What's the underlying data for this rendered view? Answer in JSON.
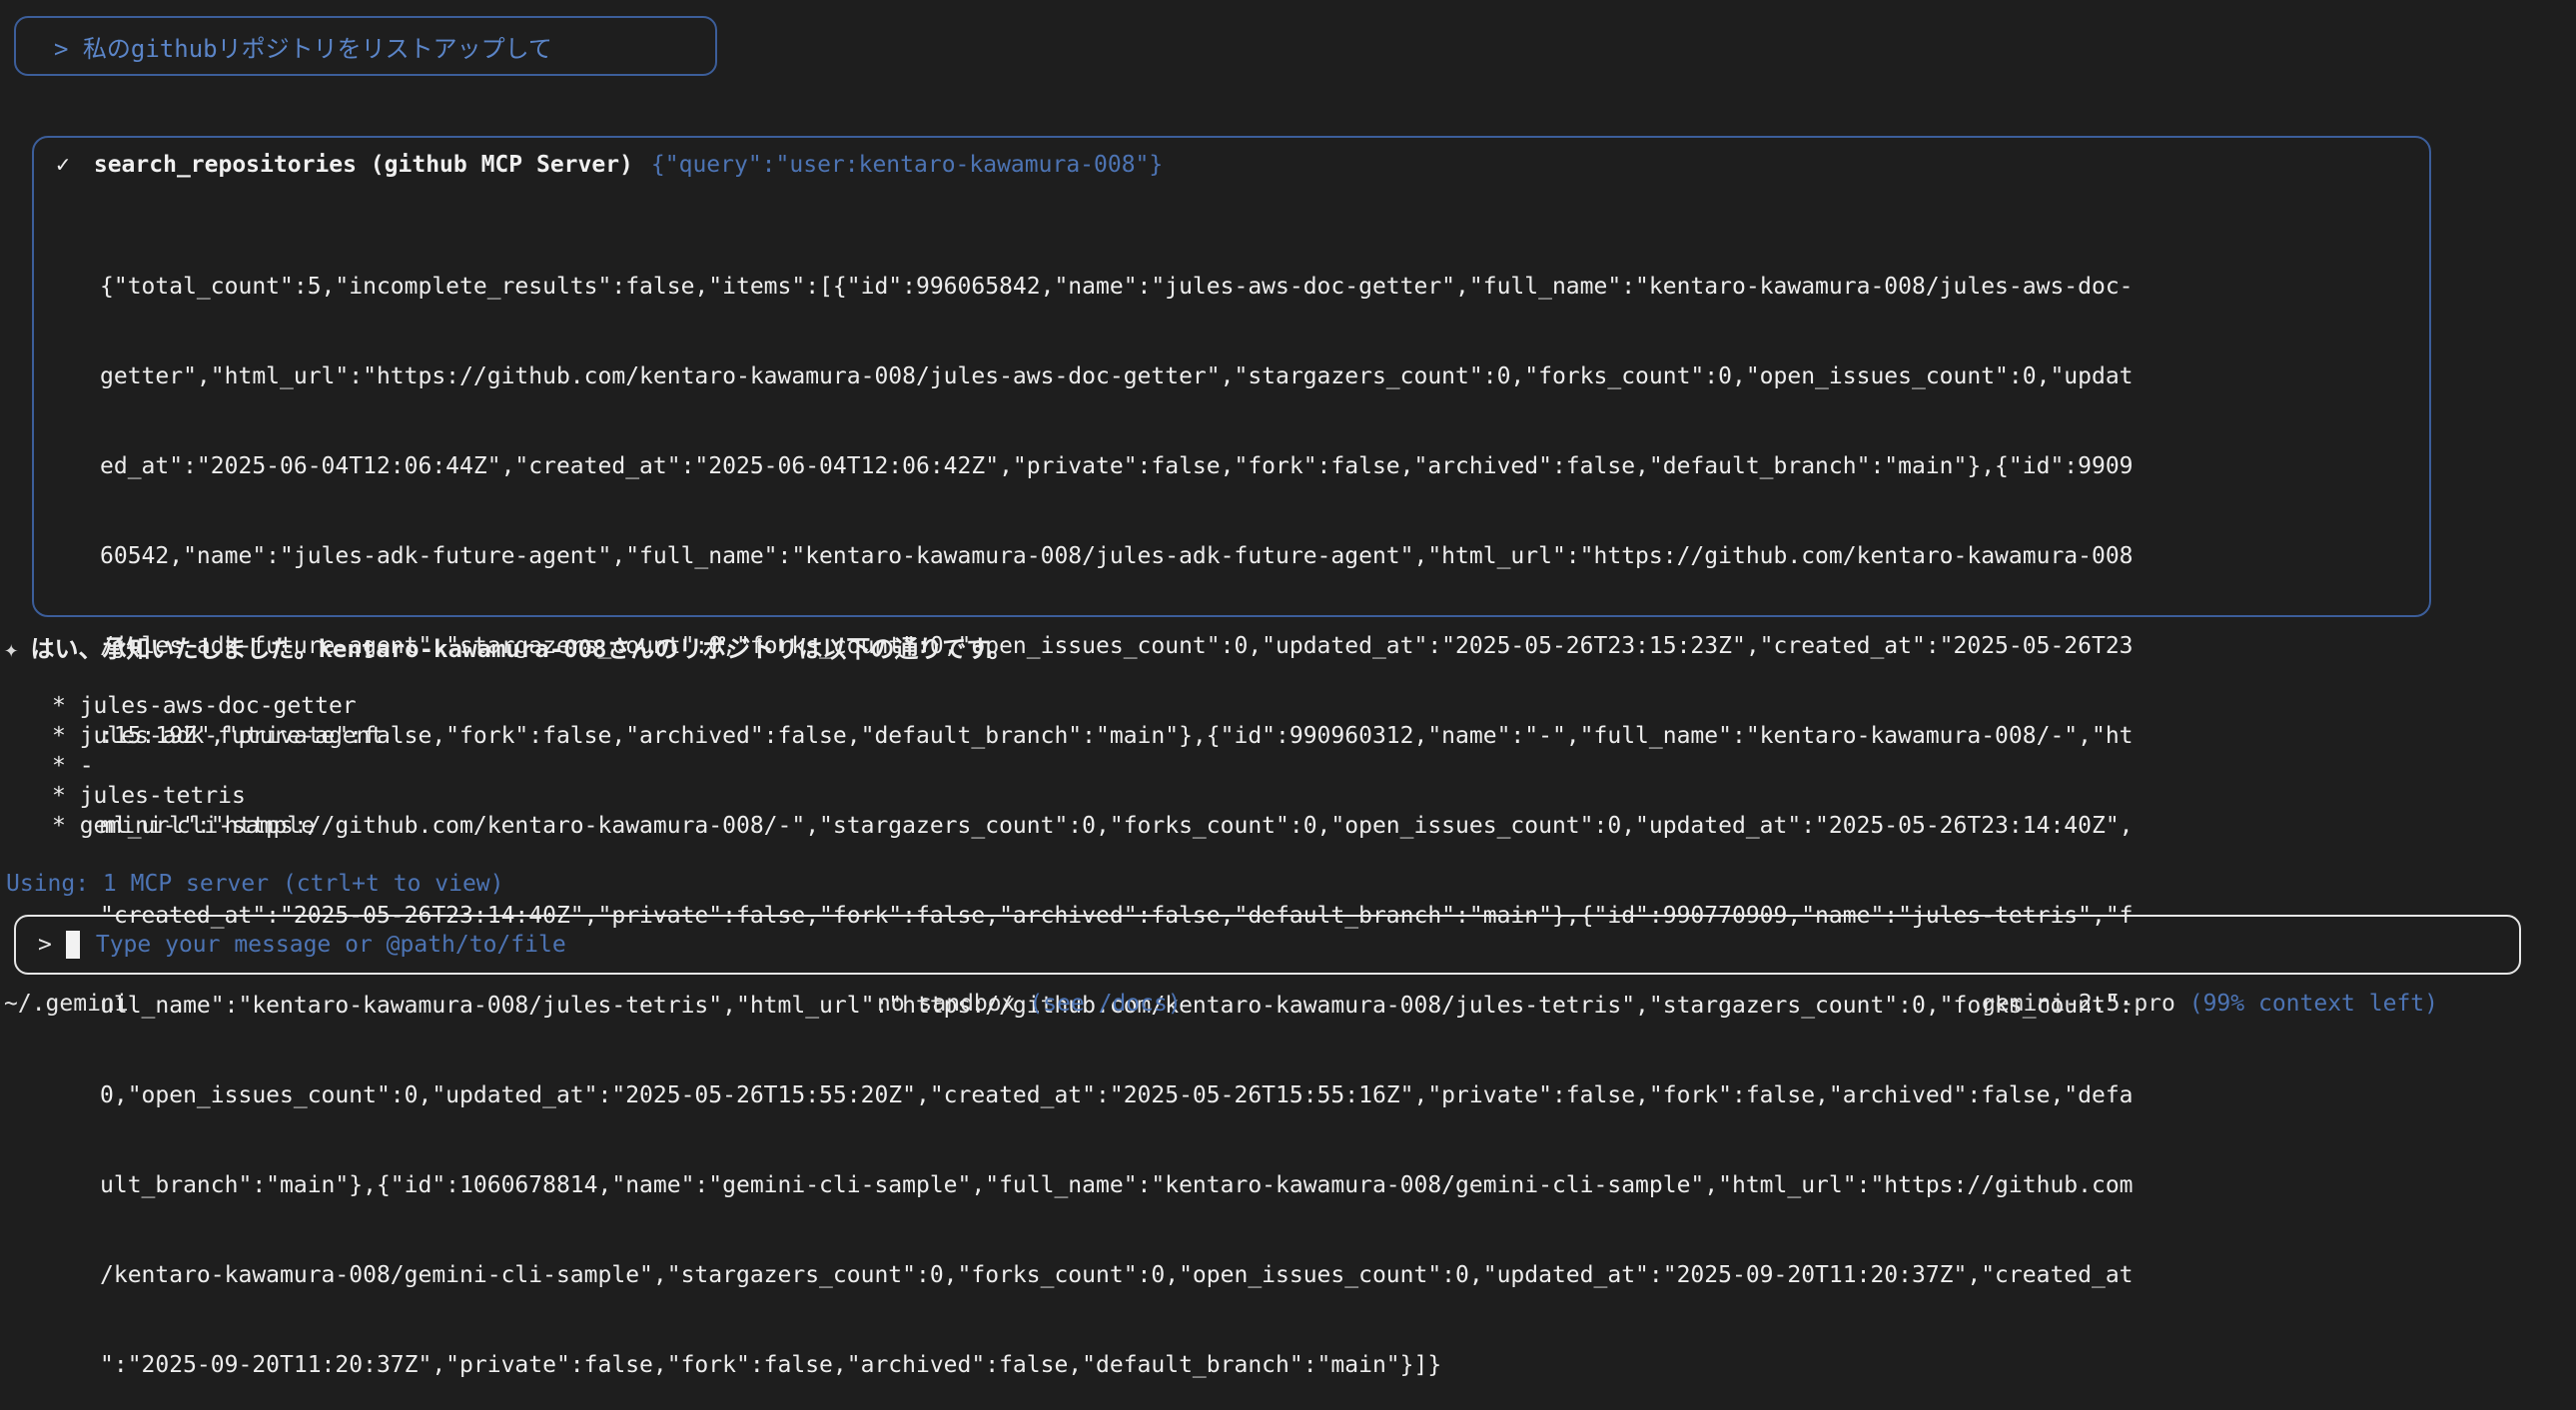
{
  "prompt_echo": "> 私のgithubリポジトリをリストアップして",
  "tool_call": {
    "status_icon": "✓",
    "name": "search_repositories (github MCP Server)",
    "args": "{\"query\":\"user:kentaro-kawamura-008\"}",
    "output_lines": [
      "{\"total_count\":5,\"incomplete_results\":false,\"items\":[{\"id\":996065842,\"name\":\"jules-aws-doc-getter\",\"full_name\":\"kentaro-kawamura-008/jules-aws-doc-",
      "getter\",\"html_url\":\"https://github.com/kentaro-kawamura-008/jules-aws-doc-getter\",\"stargazers_count\":0,\"forks_count\":0,\"open_issues_count\":0,\"updat",
      "ed_at\":\"2025-06-04T12:06:44Z\",\"created_at\":\"2025-06-04T12:06:42Z\",\"private\":false,\"fork\":false,\"archived\":false,\"default_branch\":\"main\"},{\"id\":9909",
      "60542,\"name\":\"jules-adk-future-agent\",\"full_name\":\"kentaro-kawamura-008/jules-adk-future-agent\",\"html_url\":\"https://github.com/kentaro-kawamura-008",
      "/jules-adk-future-agent\",\"stargazers_count\":0,\"forks_count\":0,\"open_issues_count\":0,\"updated_at\":\"2025-05-26T23:15:23Z\",\"created_at\":\"2025-05-26T23",
      ":15:19Z\",\"private\":false,\"fork\":false,\"archived\":false,\"default_branch\":\"main\"},{\"id\":990960312,\"name\":\"-\",\"full_name\":\"kentaro-kawamura-008/-\",\"ht",
      "ml_url\":\"https://github.com/kentaro-kawamura-008/-\",\"stargazers_count\":0,\"forks_count\":0,\"open_issues_count\":0,\"updated_at\":\"2025-05-26T23:14:40Z\",",
      "\"created_at\":\"2025-05-26T23:14:40Z\",\"private\":false,\"fork\":false,\"archived\":false,\"default_branch\":\"main\"},{\"id\":990770909,\"name\":\"jules-tetris\",\"f",
      "ull_name\":\"kentaro-kawamura-008/jules-tetris\",\"html_url\":\"https://github.com/kentaro-kawamura-008/jules-tetris\",\"stargazers_count\":0,\"forks_count\":",
      "0,\"open_issues_count\":0,\"updated_at\":\"2025-05-26T15:55:20Z\",\"created_at\":\"2025-05-26T15:55:16Z\",\"private\":false,\"fork\":false,\"archived\":false,\"defa",
      "ult_branch\":\"main\"},{\"id\":1060678814,\"name\":\"gemini-cli-sample\",\"full_name\":\"kentaro-kawamura-008/gemini-cli-sample\",\"html_url\":\"https://github.com",
      "/kentaro-kawamura-008/gemini-cli-sample\",\"stargazers_count\":0,\"forks_count\":0,\"open_issues_count\":0,\"updated_at\":\"2025-09-20T11:20:37Z\",\"created_at",
      "\":\"2025-09-20T11:20:37Z\",\"private\":false,\"fork\":false,\"archived\":false,\"default_branch\":\"main\"}]}"
    ]
  },
  "answer": {
    "icon": "✦",
    "text": "はい、承知いたしました。kentaro-kawamura-008さんのリポジトリは以下の通りです。",
    "repos": [
      "* jules-aws-doc-getter",
      "* jules-adk-future-agent",
      "* -",
      "* jules-tetris",
      "* gemini-cli-sample"
    ]
  },
  "mcp_status": "Using: 1 MCP server (ctrl+t to view)",
  "input": {
    "prompt_symbol": ">",
    "placeholder": "Type your message or @path/to/file"
  },
  "footer": {
    "cwd": "~/.gemini",
    "sandbox": "no sandbox",
    "sandbox_hint": "(see /docs)",
    "model": "gemini-2.5-pro",
    "context": "(99% context left)"
  },
  "colors": {
    "background": "#1e1e1e",
    "accent_blue": "#4d74b4",
    "border_blue": "#3c5e9a",
    "text": "#ededed"
  }
}
